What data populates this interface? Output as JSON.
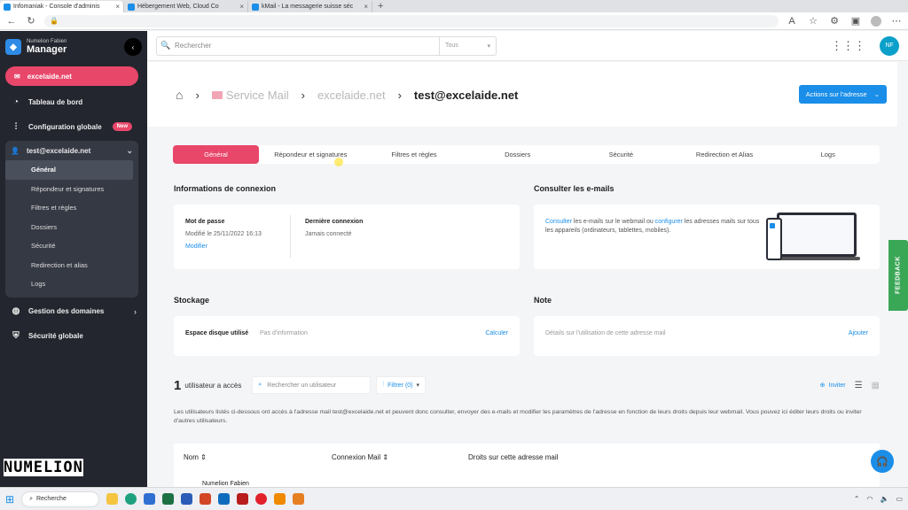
{
  "browser": {
    "tabs": [
      {
        "title": "Infomaniak - Console d'adminis",
        "color": "#1a8ee8"
      },
      {
        "title": "Hébergement Web, Cloud Co",
        "color": "#1a8ee8"
      },
      {
        "title": "kMail - La messagerie suisse séc",
        "color": "#1a8ee8"
      }
    ]
  },
  "sidebar": {
    "brand_user": "Numelion Fabien",
    "brand_title": "Manager",
    "domain": "excelaide.net",
    "nav": [
      {
        "label": "Tableau de bord",
        "icon": "dashboard-icon"
      },
      {
        "label": "Configuration globale",
        "icon": "sliders-icon",
        "badge": "New"
      }
    ],
    "mailbox": {
      "label": "test@excelaide.net",
      "items": [
        "Général",
        "Répondeur et signatures",
        "Filtres et règles",
        "Dossiers",
        "Sécurité",
        "Redirection et alias",
        "Logs"
      ]
    },
    "nav2": [
      {
        "label": "Gestion des domaines",
        "icon": "globe-icon"
      },
      {
        "label": "Sécurité globale",
        "icon": "shield-icon"
      }
    ],
    "watermark": "NUMELION"
  },
  "topbar": {
    "search_placeholder": "Rechercher",
    "scope": "Tous",
    "user_initials": "NF"
  },
  "breadcrumb": {
    "service": "Service Mail",
    "domain": "excelaide.net",
    "address": "test@excelaide.net",
    "actions": "Actions sur l'adresse"
  },
  "tabs": [
    "Général",
    "Répondeur et signatures",
    "Filtres et règles",
    "Dossiers",
    "Sécurité",
    "Redirection et Alias",
    "Logs"
  ],
  "connexion": {
    "title": "Informations de connexion",
    "password_label": "Mot de passe",
    "password_value": "Modifié le 25/11/2022 16:13",
    "modify": "Modifier",
    "last_label": "Dernière connexion",
    "last_value": "Jamais connecté"
  },
  "consult": {
    "title": "Consulter les e-mails",
    "link1": "Consulter",
    "text1": "les e-mails sur le webmail ou",
    "link2": "configurer",
    "text2": "les adresses mails sur tous les appareils (ordinateurs, tablettes, mobiles)."
  },
  "storage": {
    "title": "Stockage",
    "label": "Espace disque utilisé",
    "value": "Pas d'information",
    "action": "Calculer"
  },
  "note": {
    "title": "Note",
    "placeholder": "Détails sur l'utilisation de cette adresse mail",
    "action": "Ajouter"
  },
  "users": {
    "count": "1",
    "label": "utilisateur a accès",
    "search_placeholder": "Rechercher un utilisateur",
    "filter": "Filtrer (0)",
    "invite": "Inviter",
    "description": "Les utilisateurs listés ci-dessous ont accès à l'adresse mail test@excelaide.net et peuvent donc consulter, envoyer des e-mails et modifier les paramètres de l'adresse en fonction de leurs droits depuis leur webmail. Vous pouvez ici éditer leurs droits ou inviter d'autres utilisateurs.",
    "columns": [
      "Nom",
      "Connexion Mail",
      "Droits sur cette adresse mail"
    ],
    "first_row_name": "Numelion Fabien"
  },
  "feedback": "FEEDBACK",
  "taskbar": {
    "search": "Recherche"
  }
}
